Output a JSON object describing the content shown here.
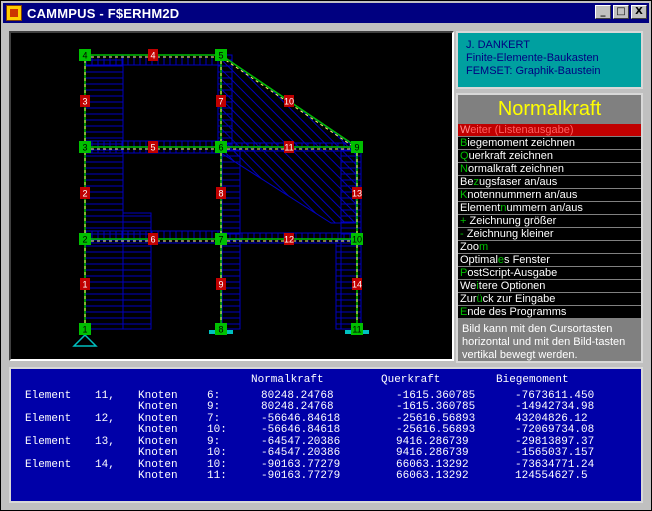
{
  "window": {
    "title": "CAMMPUS - F$ERHM2D",
    "buttons": {
      "minimize": "_",
      "maximize": "□",
      "close": "X"
    }
  },
  "info": {
    "line1": "J. DANKERT",
    "line2": "Finite-Elemente-Baukasten",
    "line3": "FEMSET:  Graphik-Baustein"
  },
  "menu": {
    "title": "Normalkraft",
    "items": [
      {
        "label": "Weiter (Listenausgabe)",
        "hk": "W",
        "rest": "eiter (Listenausgabe)",
        "active": true
      },
      {
        "label": "Biegemoment zeichnen",
        "hk": "B",
        "rest": "iegemoment zeichnen"
      },
      {
        "label": "Querkraft zeichnen",
        "hk": "Q",
        "rest": "uerkraft zeichnen"
      },
      {
        "label": "Normalkraft zeichnen",
        "hk": "N",
        "rest": "ormalkraft zeichnen"
      },
      {
        "label": "Bezugsfaser an/aus",
        "pre": "Be",
        "hk": "z",
        "rest": "ugsfaser an/aus"
      },
      {
        "label": "Knotennummern  an/aus",
        "hk": "K",
        "rest": "notennummern  an/aus"
      },
      {
        "label": "Elementnummern an/aus",
        "pre": "Element",
        "hk": "n",
        "rest": "ummern an/aus"
      },
      {
        "label": "+ Zeichnung größer",
        "hk": "+",
        "rest": " Zeichnung größer"
      },
      {
        "label": "- Zeichnung kleiner",
        "hk": "-",
        "rest": " Zeichnung kleiner"
      },
      {
        "label": "Zoom",
        "pre": "Zoo",
        "hk": "m",
        "rest": ""
      },
      {
        "label": "Optimales Fenster",
        "pre": "Optimal",
        "hk": "e",
        "rest": "s Fenster"
      },
      {
        "label": "PostScript-Ausgabe",
        "hk": "P",
        "rest": "ostScript-Ausgabe"
      },
      {
        "label": "Weitere Optionen",
        "pre": "We",
        "hk": "i",
        "rest": "tere Optionen"
      },
      {
        "label": "Zurück zur Eingabe",
        "pre": "Zur",
        "hk": "ü",
        "rest": "ck zur Eingabe"
      },
      {
        "label": "Ende des Programms",
        "hk": "E",
        "rest": "nde des Programms"
      }
    ],
    "hint": "Bild kann mit den Cursortasten horizontal und mit den Bild-tasten vertikal bewegt werden."
  },
  "canvas": {
    "nodes": [
      "1",
      "2",
      "3",
      "4",
      "5",
      "6",
      "7",
      "8",
      "9",
      "10",
      "11"
    ],
    "elements": [
      "1",
      "2",
      "3",
      "4",
      "5",
      "6",
      "7",
      "8",
      "9",
      "10",
      "11",
      "12",
      "13",
      "14"
    ]
  },
  "results": {
    "headers": {
      "normal": "Normalkraft",
      "shear": "Querkraft",
      "moment": "Biegemoment"
    },
    "rows": [
      {
        "element_label": "Element",
        "element": "11,",
        "knoten": [
          {
            "label": "Knoten",
            "node": "6:",
            "normal": "80248.24768",
            "shear": "-1615.360785",
            "moment": "-7673611.450"
          },
          {
            "label": "Knoten",
            "node": "9:",
            "normal": "80248.24768",
            "shear": "-1615.360785",
            "moment": "-14942734.98"
          }
        ]
      },
      {
        "element_label": "Element",
        "element": "12,",
        "knoten": [
          {
            "label": "Knoten",
            "node": "7:",
            "normal": "-56646.84618",
            "shear": "-25616.56893",
            "moment": "43204826.12"
          },
          {
            "label": "Knoten",
            "node": "10:",
            "normal": "-56646.84618",
            "shear": "-25616.56893",
            "moment": "-72069734.08"
          }
        ]
      },
      {
        "element_label": "Element",
        "element": "13,",
        "knoten": [
          {
            "label": "Knoten",
            "node": "9:",
            "normal": "-64547.20386",
            "shear": "9416.286739",
            "moment": "-29813897.37"
          },
          {
            "label": "Knoten",
            "node": "10:",
            "normal": "-64547.20386",
            "shear": "9416.286739",
            "moment": "-1565037.157"
          }
        ]
      },
      {
        "element_label": "Element",
        "element": "14,",
        "knoten": [
          {
            "label": "Knoten",
            "node": "10:",
            "normal": "-90163.77279",
            "shear": "66063.13292",
            "moment": "-73634771.24"
          },
          {
            "label": "Knoten",
            "node": "11:",
            "normal": "-90163.77279",
            "shear": "66063.13292",
            "moment": "124554627.5"
          }
        ]
      }
    ]
  },
  "colors": {
    "node_fill": "#00c000",
    "element_fill": "#c00000",
    "frame_line": "#00c000",
    "hatch": "#0000c0",
    "results_bg": "#0000a8"
  }
}
